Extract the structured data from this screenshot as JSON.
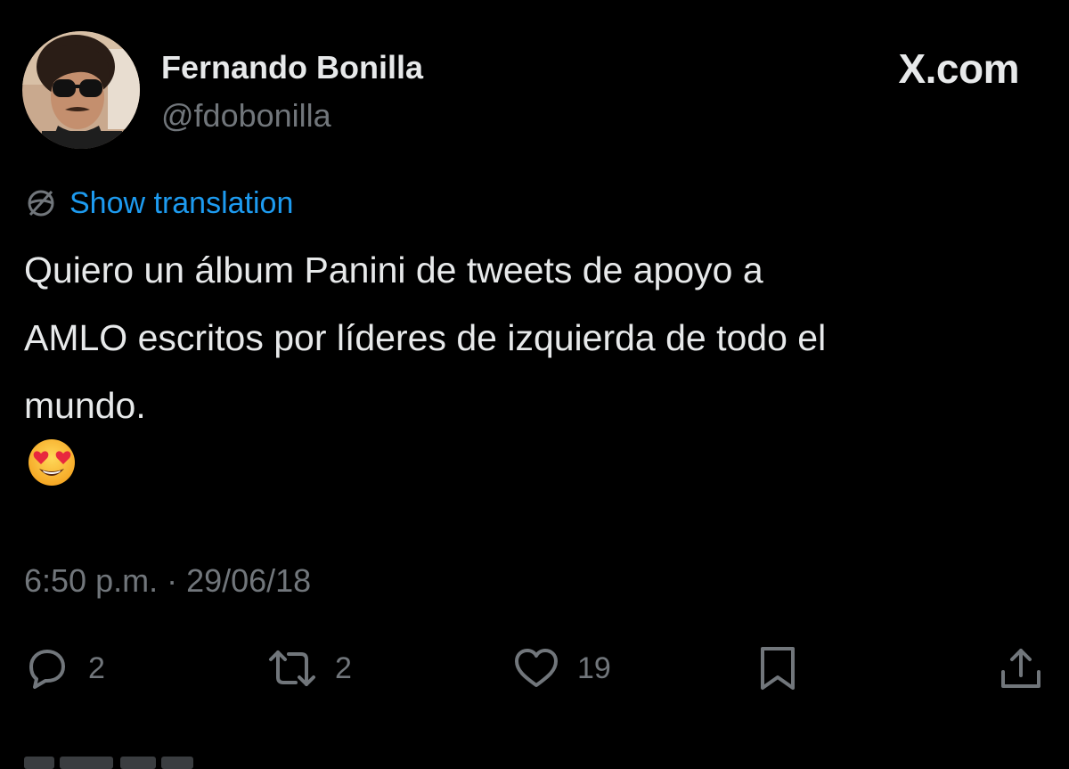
{
  "author": {
    "name": "Fernando Bonilla",
    "handle": "@fdobonilla",
    "avatar_icon": "profile-photo"
  },
  "brand": {
    "label": "X.com"
  },
  "translation": {
    "icon": "globe-icon",
    "label": "Show translation"
  },
  "tweet": {
    "lines": [
      "Quiero un álbum Panini de tweets de apoyo a",
      "AMLO escritos por líderes de izquierda de todo el",
      "mundo."
    ],
    "emoji": "😍"
  },
  "timestamp": "6:50 p.m. · 29/06/18",
  "actions": {
    "reply": {
      "icon": "reply-icon",
      "count": "2"
    },
    "repost": {
      "icon": "repost-icon",
      "count": "2"
    },
    "like": {
      "icon": "heart-icon",
      "count": "19"
    },
    "bookmark": {
      "icon": "bookmark-icon",
      "count": ""
    },
    "share": {
      "icon": "share-icon",
      "count": ""
    }
  },
  "colors": {
    "background": "#000000",
    "text": "#e7e9ea",
    "secondary": "#71767b",
    "link": "#1d9bf0"
  }
}
